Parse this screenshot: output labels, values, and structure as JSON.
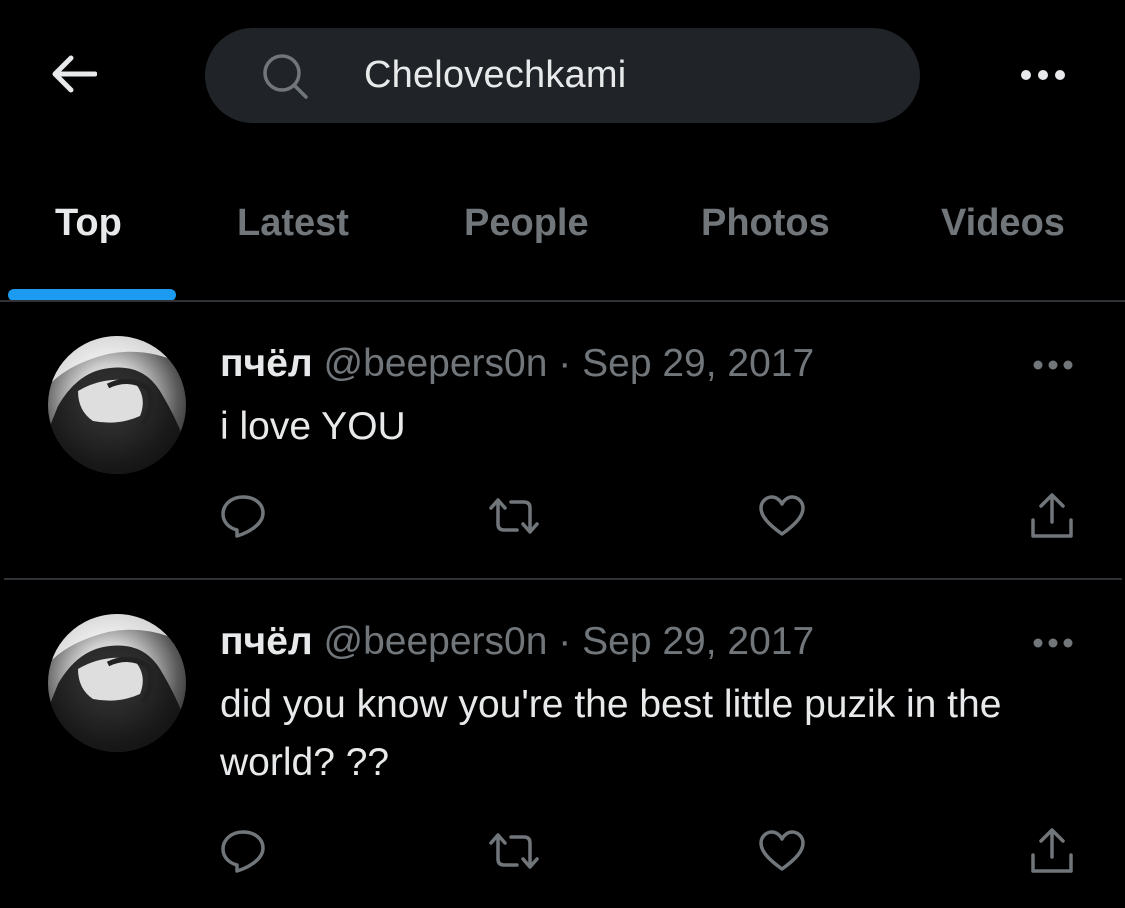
{
  "header": {
    "back_icon": "arrow-left-icon",
    "search_icon": "search-icon",
    "search_query": "Chelovechkami",
    "more_icon": "more-horizontal-icon"
  },
  "tabs": [
    {
      "label": "Top",
      "active": true
    },
    {
      "label": "Latest",
      "active": false
    },
    {
      "label": "People",
      "active": false
    },
    {
      "label": "Photos",
      "active": false
    },
    {
      "label": "Videos",
      "active": false
    }
  ],
  "tweets": [
    {
      "name": "пчёл",
      "handle": "@beepers0n",
      "separator": "·",
      "date": "Sep 29, 2017",
      "text": "i love YOU"
    },
    {
      "name": "пчёл",
      "handle": "@beepers0n",
      "separator": "·",
      "date": "Sep 29, 2017",
      "text_line1": "did you know you're the best little puzik in the",
      "text_line2": "world? ??"
    }
  ],
  "actions": [
    "reply-icon",
    "retweet-icon",
    "like-icon",
    "share-icon"
  ],
  "colors": {
    "background": "#000000",
    "search_bg": "#202327",
    "primary_text": "#e7e9ea",
    "secondary_text": "#71767b",
    "accent": "#1d9bf0",
    "divider": "#2f3336"
  }
}
